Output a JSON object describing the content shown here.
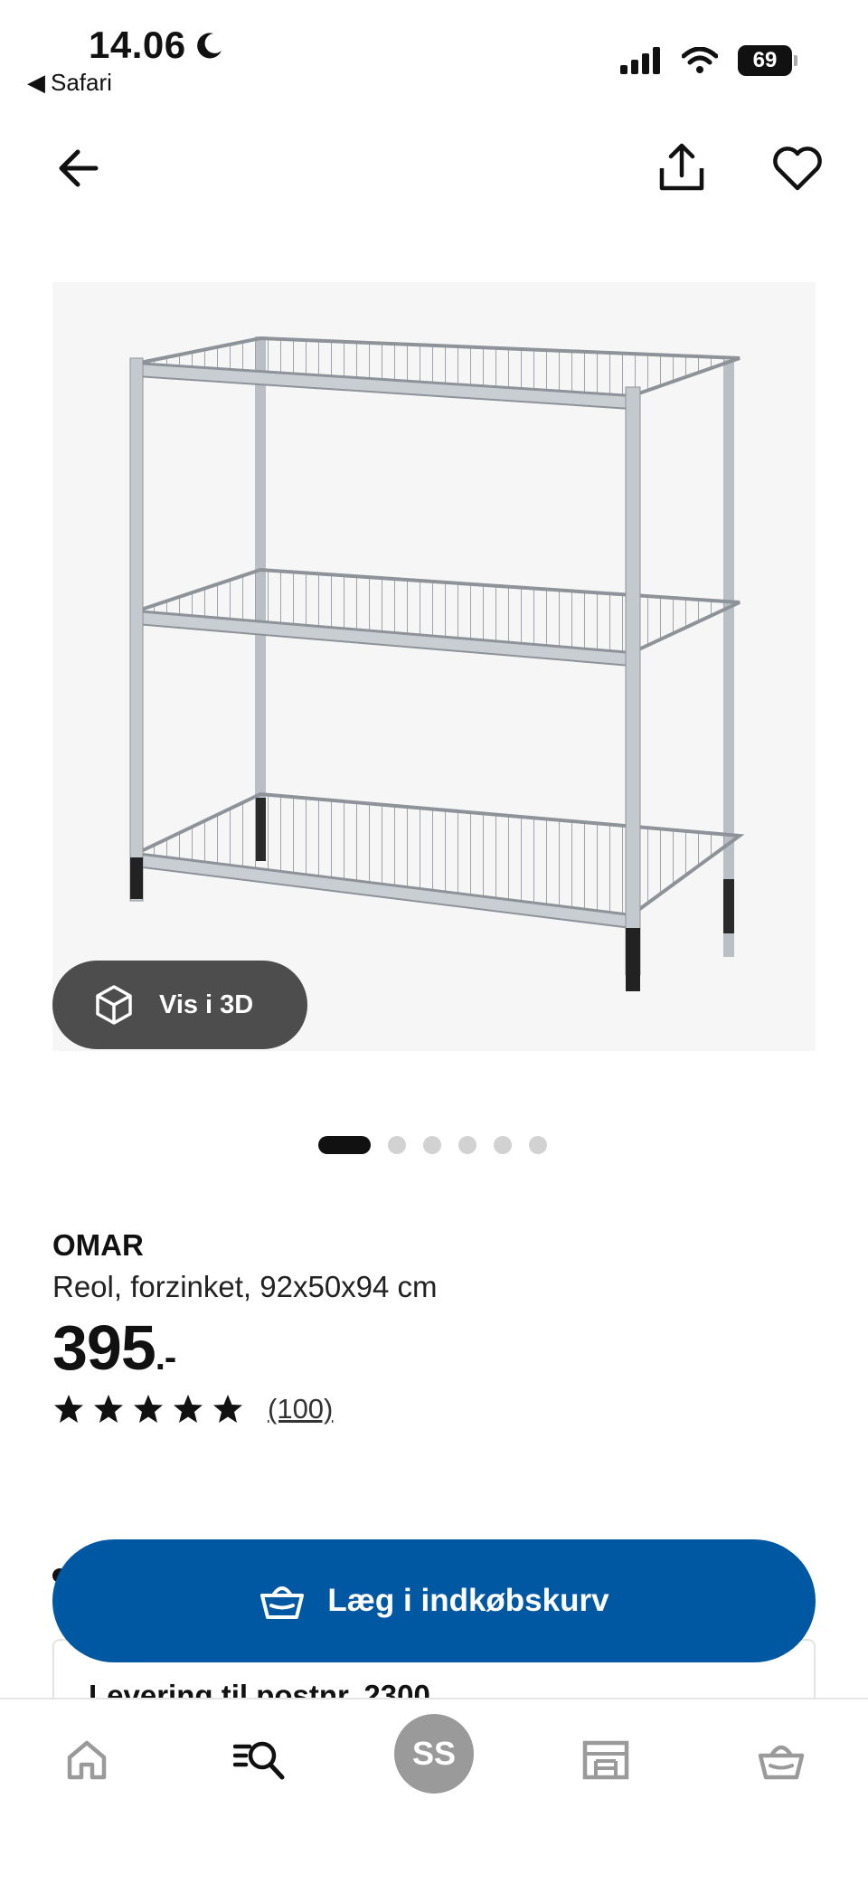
{
  "status_bar": {
    "time": "14.06",
    "back_app": "Safari",
    "battery": "69"
  },
  "header": {
    "back_icon": "arrow-left-icon",
    "share_icon": "share-icon",
    "favorite_icon": "heart-icon"
  },
  "gallery": {
    "view_3d_label": "Vis i 3D",
    "image_count": 6,
    "active_index": 0
  },
  "product": {
    "name": "OMAR",
    "description": "Reol, forzinket, 92x50x94 cm",
    "price": "395",
    "price_suffix": ".-",
    "rating_stars": 5,
    "review_count": "(100)"
  },
  "actions": {
    "add_to_cart_label": "Læg i indkøbskurv",
    "primary_color": "#0058a3"
  },
  "delivery": {
    "label": "Levering til postnr. 2300"
  },
  "bottom_nav": {
    "avatar_initials": "SS",
    "items": [
      "home-icon",
      "search-icon",
      "profile-avatar",
      "store-icon",
      "cart-icon"
    ]
  }
}
